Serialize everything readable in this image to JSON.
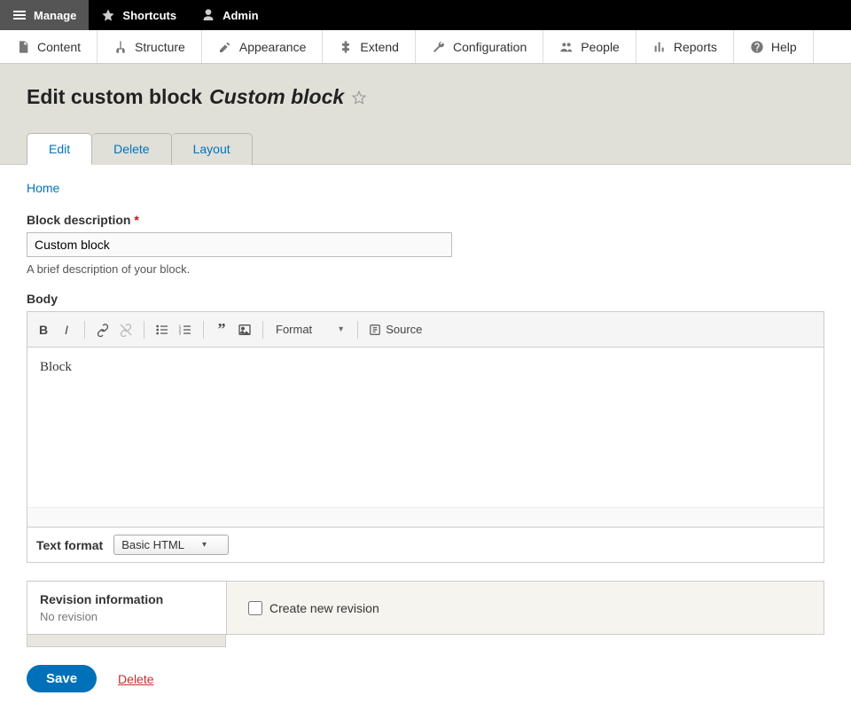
{
  "toolbar_top": {
    "manage": "Manage",
    "shortcuts": "Shortcuts",
    "admin": "Admin"
  },
  "admin_nav": [
    {
      "key": "content",
      "label": "Content"
    },
    {
      "key": "structure",
      "label": "Structure"
    },
    {
      "key": "appearance",
      "label": "Appearance"
    },
    {
      "key": "extend",
      "label": "Extend"
    },
    {
      "key": "configuration",
      "label": "Configuration"
    },
    {
      "key": "people",
      "label": "People"
    },
    {
      "key": "reports",
      "label": "Reports"
    },
    {
      "key": "help",
      "label": "Help"
    }
  ],
  "page_title": {
    "prefix": "Edit custom block ",
    "emphasis": "Custom block"
  },
  "tabs": [
    {
      "key": "edit",
      "label": "Edit",
      "active": true
    },
    {
      "key": "delete",
      "label": "Delete",
      "active": false
    },
    {
      "key": "layout",
      "label": "Layout",
      "active": false
    }
  ],
  "breadcrumb": "Home",
  "block_description": {
    "label": "Block description",
    "value": "Custom block",
    "help": "A brief description of your block."
  },
  "body": {
    "label": "Body",
    "content": "Block",
    "format_menu_label": "Format",
    "source_label": "Source"
  },
  "text_format": {
    "label": "Text format",
    "selected": "Basic HTML"
  },
  "revision": {
    "title": "Revision information",
    "subtitle": "No revision",
    "checkbox_label": "Create new revision"
  },
  "actions": {
    "save": "Save",
    "delete": "Delete"
  }
}
